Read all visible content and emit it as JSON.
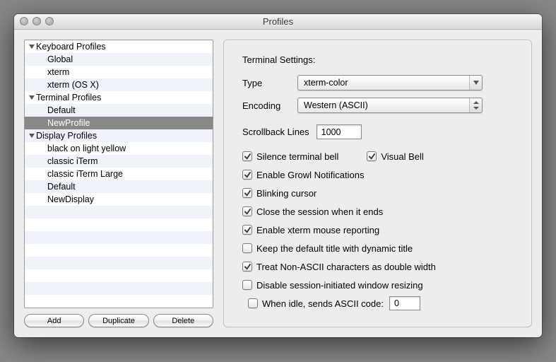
{
  "window": {
    "title": "Profiles"
  },
  "sidebar": {
    "groups": [
      {
        "label": "Keyboard Profiles",
        "items": [
          "Global",
          "xterm",
          "xterm (OS X)"
        ]
      },
      {
        "label": "Terminal Profiles",
        "items": [
          "Default",
          "NewProfile"
        ]
      },
      {
        "label": "Display Profiles",
        "items": [
          "black on light yellow",
          "classic iTerm",
          "classic iTerm Large",
          "Default",
          "NewDisplay"
        ]
      }
    ],
    "buttons": {
      "add": "Add",
      "duplicate": "Duplicate",
      "delete": "Delete"
    },
    "selected": "NewProfile"
  },
  "settings": {
    "section_title": "Terminal Settings:",
    "type_label": "Type",
    "type_value": "xterm-color",
    "encoding_label": "Encoding",
    "encoding_value": "Western (ASCII)",
    "scrollback_label": "Scrollback Lines",
    "scrollback_value": "1000",
    "checks": {
      "silence_bell": {
        "label": "Silence terminal bell",
        "checked": true
      },
      "visual_bell": {
        "label": "Visual Bell",
        "checked": true
      },
      "growl": {
        "label": "Enable Growl Notifications",
        "checked": true
      },
      "blink": {
        "label": "Blinking cursor",
        "checked": true
      },
      "close_end": {
        "label": "Close the session when it ends",
        "checked": true
      },
      "xterm_mouse": {
        "label": "Enable xterm mouse reporting",
        "checked": true
      },
      "keep_title": {
        "label": "Keep the default title with dynamic title",
        "checked": false
      },
      "double_width": {
        "label": "Treat Non-ASCII characters as double width",
        "checked": true
      },
      "no_resize": {
        "label": "Disable session-initiated window resizing",
        "checked": false
      },
      "idle": {
        "label": "When idle, sends ASCII code:",
        "checked": false,
        "value": "0"
      }
    }
  }
}
